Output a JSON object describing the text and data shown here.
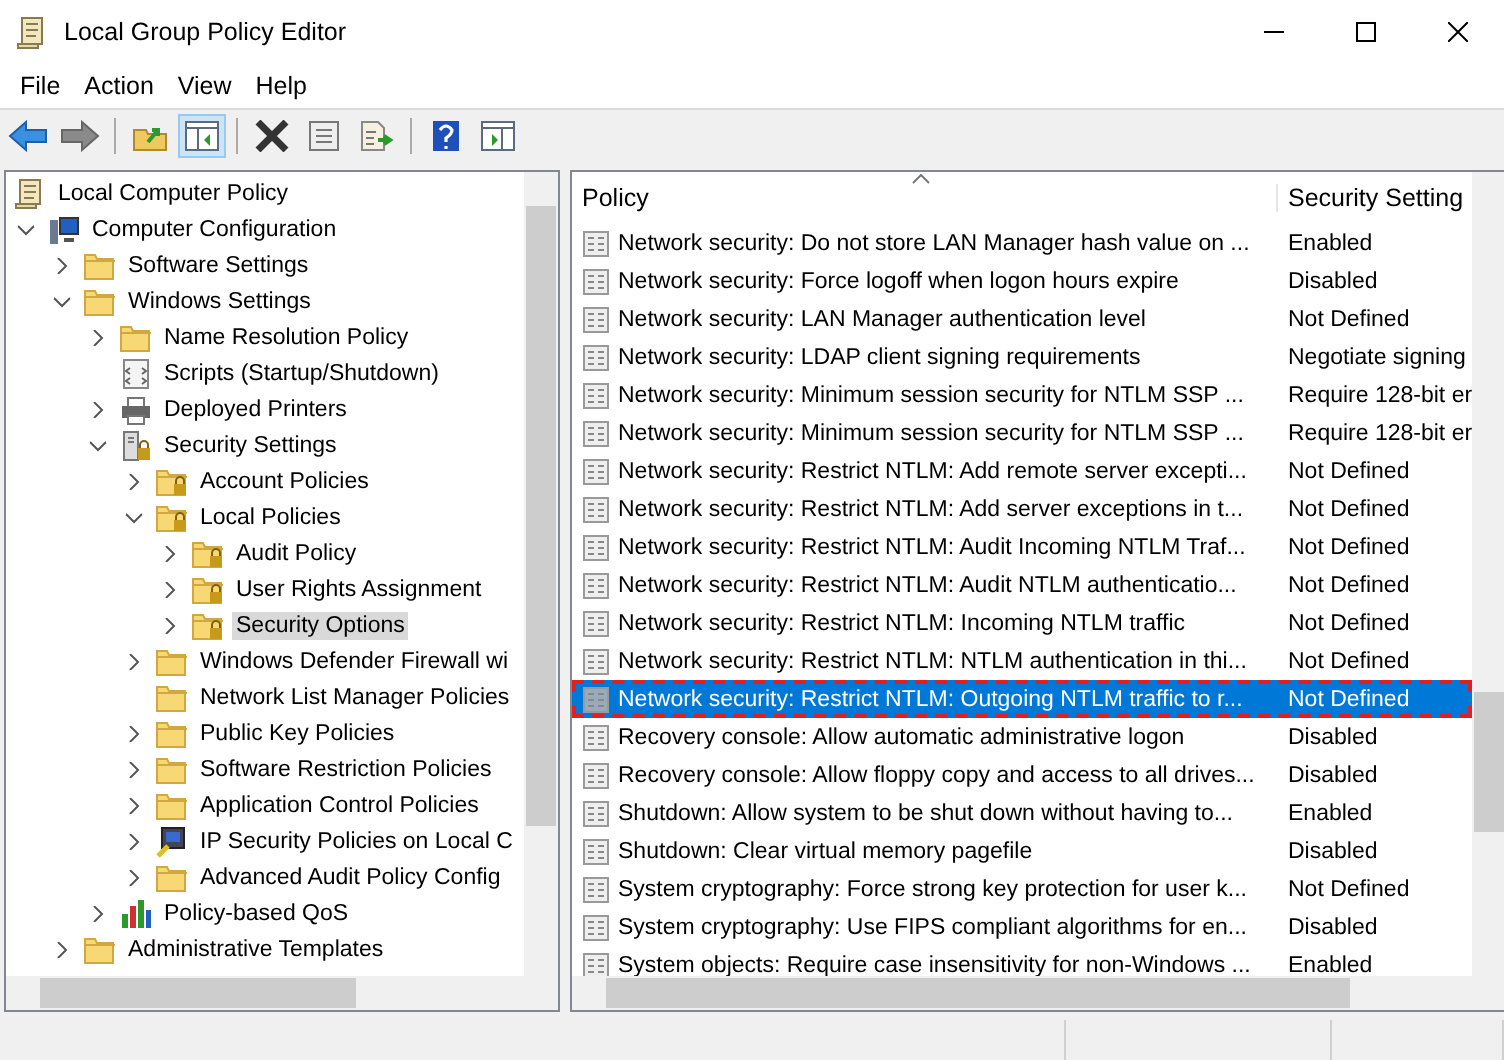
{
  "window": {
    "title": "Local Group Policy Editor"
  },
  "menu": [
    {
      "label": "File"
    },
    {
      "label": "Action"
    },
    {
      "label": "View"
    },
    {
      "label": "Help"
    }
  ],
  "toolbar": [
    {
      "buttons": [
        {
          "kind": "back",
          "pressed": false
        },
        {
          "kind": "forward",
          "pressed": false
        }
      ]
    },
    {
      "buttons": [
        {
          "kind": "up",
          "pressed": false
        },
        {
          "kind": "tree",
          "pressed": true
        }
      ]
    },
    {
      "buttons": [
        {
          "kind": "delete",
          "pressed": false
        },
        {
          "kind": "properties",
          "pressed": false
        },
        {
          "kind": "export",
          "pressed": false
        }
      ]
    },
    {
      "buttons": [
        {
          "kind": "help",
          "pressed": false
        },
        {
          "kind": "actionpane",
          "pressed": false
        }
      ]
    }
  ],
  "tree": [
    {
      "label": "Local Computer Policy",
      "kind": "policy",
      "selected": false,
      "children": [
        {
          "label": "Computer Configuration",
          "kind": "computer",
          "expanded": true,
          "selected": false,
          "children": [
            {
              "label": "Software Settings",
              "kind": "folder",
              "expanded": false,
              "selected": false
            },
            {
              "label": "Windows Settings",
              "kind": "folder",
              "expanded": true,
              "selected": false,
              "children": [
                {
                  "label": "Name Resolution Policy",
                  "kind": "folder",
                  "expanded": false,
                  "selected": false
                },
                {
                  "label": "Scripts (Startup/Shutdown)",
                  "kind": "scripts",
                  "selected": false
                },
                {
                  "label": "Deployed Printers",
                  "kind": "printer",
                  "expanded": false,
                  "selected": false
                },
                {
                  "label": "Security Settings",
                  "kind": "security",
                  "expanded": true,
                  "selected": false,
                  "children": [
                    {
                      "label": "Account Policies",
                      "kind": "lockfolder",
                      "expanded": false,
                      "selected": false
                    },
                    {
                      "label": "Local Policies",
                      "kind": "lockfolder",
                      "expanded": true,
                      "selected": false,
                      "children": [
                        {
                          "label": "Audit Policy",
                          "kind": "lockfolder",
                          "expanded": false,
                          "selected": false
                        },
                        {
                          "label": "User Rights Assignment",
                          "kind": "lockfolder",
                          "expanded": false,
                          "selected": false
                        },
                        {
                          "label": "Security Options",
                          "kind": "lockfolder",
                          "expanded": false,
                          "selected": true
                        }
                      ]
                    },
                    {
                      "label": "Windows Defender Firewall wi",
                      "kind": "folder",
                      "expanded": false,
                      "selected": false
                    },
                    {
                      "label": "Network List Manager Policies",
                      "kind": "folder",
                      "selected": false
                    },
                    {
                      "label": "Public Key Policies",
                      "kind": "folder",
                      "expanded": false,
                      "selected": false
                    },
                    {
                      "label": "Software Restriction Policies",
                      "kind": "folder",
                      "expanded": false,
                      "selected": false
                    },
                    {
                      "label": "Application Control Policies",
                      "kind": "folder",
                      "expanded": false,
                      "selected": false
                    },
                    {
                      "label": "IP Security Policies on Local C",
                      "kind": "ipsec",
                      "expanded": false,
                      "selected": false
                    },
                    {
                      "label": "Advanced Audit Policy Config",
                      "kind": "folder",
                      "expanded": false,
                      "selected": false
                    }
                  ]
                },
                {
                  "label": "Policy-based QoS",
                  "kind": "qos",
                  "expanded": false,
                  "selected": false
                }
              ]
            },
            {
              "label": "Administrative Templates",
              "kind": "folder",
              "expanded": false,
              "selected": false
            }
          ]
        }
      ]
    }
  ],
  "table": {
    "columns": [
      "Policy",
      "Security Setting"
    ],
    "rows": [
      {
        "policy": "Network security: Do not store LAN Manager hash value on ...",
        "setting": "Enabled",
        "selected": false
      },
      {
        "policy": "Network security: Force logoff when logon hours expire",
        "setting": "Disabled",
        "selected": false
      },
      {
        "policy": "Network security: LAN Manager authentication level",
        "setting": "Not Defined",
        "selected": false
      },
      {
        "policy": "Network security: LDAP client signing requirements",
        "setting": "Negotiate signing",
        "selected": false
      },
      {
        "policy": "Network security: Minimum session security for NTLM SSP ...",
        "setting": "Require 128-bit er",
        "selected": false
      },
      {
        "policy": "Network security: Minimum session security for NTLM SSP ...",
        "setting": "Require 128-bit er",
        "selected": false
      },
      {
        "policy": "Network security: Restrict NTLM: Add remote server excepti...",
        "setting": "Not Defined",
        "selected": false
      },
      {
        "policy": "Network security: Restrict NTLM: Add server exceptions in t...",
        "setting": "Not Defined",
        "selected": false
      },
      {
        "policy": "Network security: Restrict NTLM: Audit Incoming NTLM Traf...",
        "setting": "Not Defined",
        "selected": false
      },
      {
        "policy": "Network security: Restrict NTLM: Audit NTLM authenticatio...",
        "setting": "Not Defined",
        "selected": false
      },
      {
        "policy": "Network security: Restrict NTLM: Incoming NTLM traffic",
        "setting": "Not Defined",
        "selected": false
      },
      {
        "policy": "Network security: Restrict NTLM: NTLM authentication in thi...",
        "setting": "Not Defined",
        "selected": false
      },
      {
        "policy": "Network security: Restrict NTLM: Outgoing NTLM traffic to r...",
        "setting": "Not Defined",
        "selected": true
      },
      {
        "policy": "Recovery console: Allow automatic administrative logon",
        "setting": "Disabled",
        "selected": false
      },
      {
        "policy": "Recovery console: Allow floppy copy and access to all drives...",
        "setting": "Disabled",
        "selected": false
      },
      {
        "policy": "Shutdown: Allow system to be shut down without having to...",
        "setting": "Enabled",
        "selected": false
      },
      {
        "policy": "Shutdown: Clear virtual memory pagefile",
        "setting": "Disabled",
        "selected": false
      },
      {
        "policy": "System cryptography: Force strong key protection for user k...",
        "setting": "Not Defined",
        "selected": false
      },
      {
        "policy": "System cryptography: Use FIPS compliant algorithms for en...",
        "setting": "Disabled",
        "selected": false
      },
      {
        "policy": "System objects: Require case insensitivity for non-Windows ...",
        "setting": "Enabled",
        "selected": false
      }
    ]
  }
}
